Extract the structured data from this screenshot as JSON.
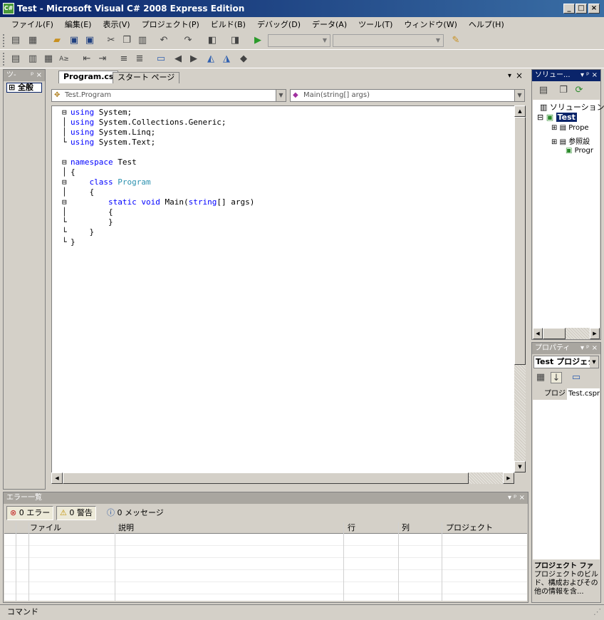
{
  "window": {
    "title": "Test - Microsoft Visual C# 2008 Express Edition",
    "icon_label": "C#"
  },
  "menu": [
    "ファイル(F)",
    "編集(E)",
    "表示(V)",
    "プロジェクト(P)",
    "ビルド(B)",
    "デバッグ(D)",
    "データ(A)",
    "ツール(T)",
    "ウィンドウ(W)",
    "ヘルプ(H)"
  ],
  "toolbox": {
    "title": "ツ-",
    "item": "全般"
  },
  "editor": {
    "tabs": [
      "Program.cs",
      "スタート ページ"
    ],
    "class_combo": "Test.Program",
    "member_combo": "Main(string[] args)",
    "code": [
      "using System;",
      "using System.Collections.Generic;",
      "using System.Linq;",
      "using System.Text;",
      "",
      "namespace Test",
      "{",
      "    class Program",
      "    {",
      "        static void Main(string[] args)",
      "        {",
      "        }",
      "    }",
      "}"
    ]
  },
  "solution": {
    "title": "ソリュー...",
    "root": "ソリューション",
    "project": "Test",
    "items": [
      "Prope",
      "参照設",
      "Progr"
    ]
  },
  "properties": {
    "title": "プロパティ",
    "object": "Test プロジェク",
    "row_name": "プロジ",
    "row_value": "Test.cspr",
    "desc_title": "プロジェクト ファ",
    "desc_text": "プロジェクトのビルド、構成およびその他の情報を含..."
  },
  "errorlist": {
    "title": "エラー一覧",
    "errors": "0 エラー",
    "warnings": "0 警告",
    "messages": "0 メッセージ",
    "columns": [
      "ファイル",
      "説明",
      "行",
      "列",
      "プロジェクト"
    ]
  },
  "status": {
    "text": "コマンド"
  }
}
